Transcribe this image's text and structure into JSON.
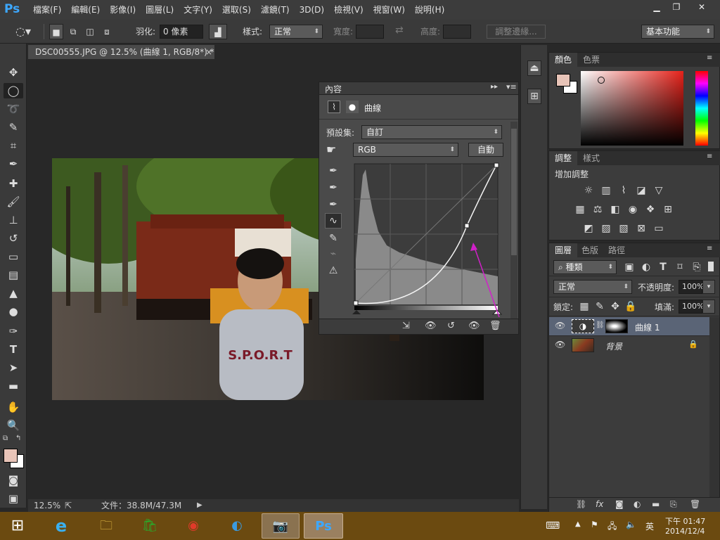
{
  "app": {
    "logo": "Ps"
  },
  "menu": [
    "檔案(F)",
    "編輯(E)",
    "影像(I)",
    "圖層(L)",
    "文字(Y)",
    "選取(S)",
    "濾鏡(T)",
    "3D(D)",
    "檢視(V)",
    "視窗(W)",
    "說明(H)"
  ],
  "options": {
    "feather_label": "羽化:",
    "feather_value": "0 像素",
    "style_label": "樣式:",
    "style_value": "正常",
    "width_label": "寬度:",
    "height_label": "高度:",
    "refine_edge": "調整邊緣...",
    "workspace": "基本功能"
  },
  "document": {
    "tab_title": "DSC00555.JPG @ 12.5% (曲線 1, RGB/8*) *"
  },
  "status": {
    "zoom": "12.5%",
    "doc_size": "文件：38.8M/47.3M"
  },
  "properties": {
    "tab": "內容",
    "type_label": "曲線",
    "preset_label": "預設集:",
    "preset_value": "自訂",
    "channel_value": "RGB",
    "auto_button": "自動"
  },
  "color_panel": {
    "tabs": [
      "顏色",
      "色票"
    ],
    "fg_color": "#e8c4b8",
    "bg_color": "#ffffff"
  },
  "adjust_panel": {
    "tabs": [
      "調整",
      "樣式"
    ],
    "heading": "增加調整"
  },
  "layers_panel": {
    "tabs": [
      "圖層",
      "色版",
      "路徑"
    ],
    "filter": "種類",
    "blend": "正常",
    "opacity_label": "不透明度:",
    "opacity": "100%",
    "lock_label": "鎖定:",
    "fill_label": "填滿:",
    "fill": "100%",
    "layers": [
      {
        "name": "曲線 1",
        "selected": true
      },
      {
        "name": "背景",
        "selected": false
      }
    ]
  },
  "taskbar": {
    "ime": "英",
    "time": "下午 01:47",
    "date": "2014/12/4"
  }
}
